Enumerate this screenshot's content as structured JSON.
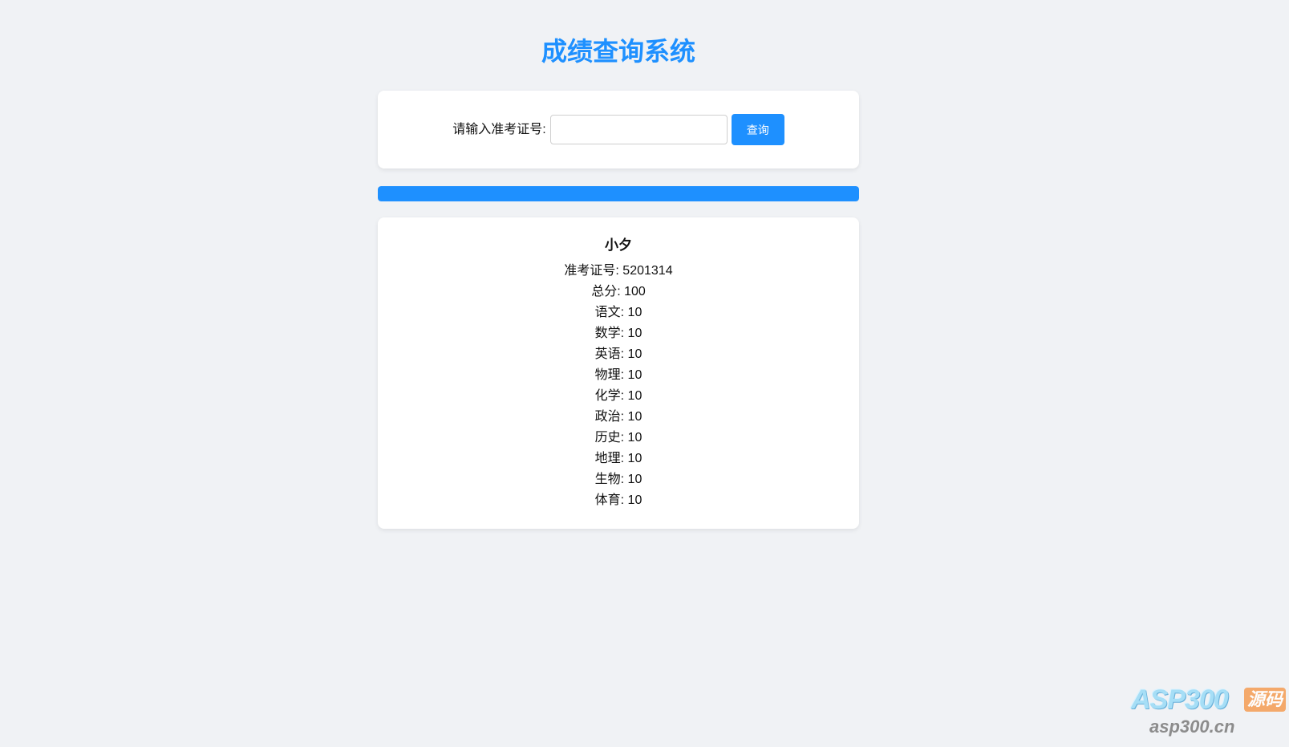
{
  "page": {
    "title": "成绩查询系统"
  },
  "search": {
    "label": "请输入准考证号:",
    "input_value": "",
    "button_label": "查询"
  },
  "progress": {
    "percent": 100
  },
  "result": {
    "name": "小夕",
    "separator": ": ",
    "rows": [
      {
        "label": "准考证号",
        "value": "5201314"
      },
      {
        "label": "总分",
        "value": "100"
      },
      {
        "label": "语文",
        "value": "10"
      },
      {
        "label": "数学",
        "value": "10"
      },
      {
        "label": "英语",
        "value": "10"
      },
      {
        "label": "物理",
        "value": "10"
      },
      {
        "label": "化学",
        "value": "10"
      },
      {
        "label": "政治",
        "value": "10"
      },
      {
        "label": "历史",
        "value": "10"
      },
      {
        "label": "地理",
        "value": "10"
      },
      {
        "label": "生物",
        "value": "10"
      },
      {
        "label": "体育",
        "value": "10"
      }
    ]
  },
  "watermark": {
    "brand": "ASP300",
    "tag": "源码",
    "domain": "asp300.cn"
  },
  "colors": {
    "accent": "#1e90ff",
    "background": "#f0f2f5",
    "card": "#ffffff"
  }
}
